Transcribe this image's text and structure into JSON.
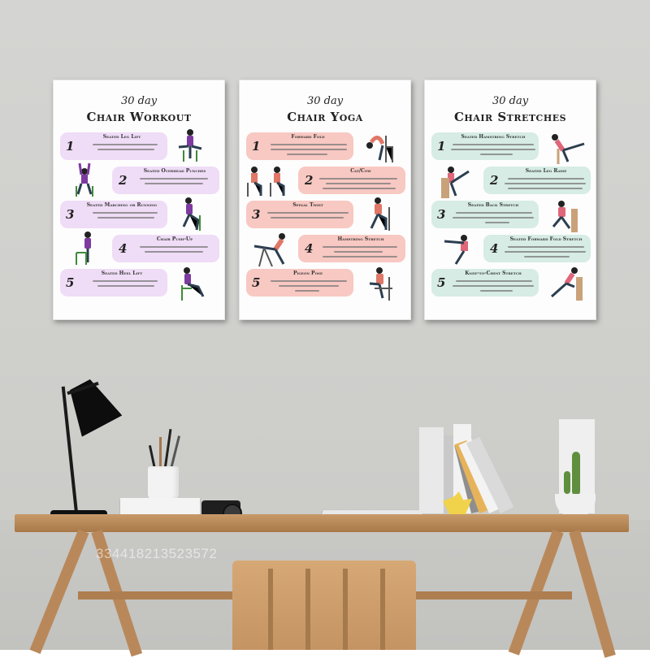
{
  "posters": [
    {
      "subtitle": "30 day",
      "title": "Chair Workout",
      "accent": "#efdcf6",
      "figure_color": "#7d3aa0",
      "items": [
        {
          "num": "1",
          "label": "Seated Leg Lift",
          "side": "left"
        },
        {
          "num": "2",
          "label": "Seated Overhead Punches",
          "side": "right"
        },
        {
          "num": "3",
          "label": "Seated Marching or Running",
          "side": "left"
        },
        {
          "num": "4",
          "label": "Chair Push-Up",
          "side": "right"
        },
        {
          "num": "5",
          "label": "Seated Heel Lift",
          "side": "left"
        }
      ]
    },
    {
      "subtitle": "30 day",
      "title": "Chair Yoga",
      "accent": "#f8c8c2",
      "figure_color": "#e07767",
      "items": [
        {
          "num": "1",
          "label": "Forward Fold",
          "side": "left"
        },
        {
          "num": "2",
          "label": "Cat/Cow",
          "side": "right"
        },
        {
          "num": "3",
          "label": "Spinal Twist",
          "side": "left"
        },
        {
          "num": "4",
          "label": "Hamstring Stretch",
          "side": "right"
        },
        {
          "num": "5",
          "label": "Pigeon Pose",
          "side": "left"
        }
      ]
    },
    {
      "subtitle": "30 day",
      "title": "Chair Stretches",
      "accent": "#d6ece4",
      "figure_color": "#e0667a",
      "items": [
        {
          "num": "1",
          "label": "Seated Hamstring Stretch",
          "side": "left"
        },
        {
          "num": "2",
          "label": "Seated Leg Raise",
          "side": "right"
        },
        {
          "num": "3",
          "label": "Seated Back Stretch",
          "side": "left"
        },
        {
          "num": "4",
          "label": "Seated Forward Fold Stretch",
          "side": "right"
        },
        {
          "num": "5",
          "label": "Knee-to-Chest Stretch",
          "side": "left"
        }
      ]
    }
  ],
  "watermark": "334418213523572",
  "colors": {
    "wall": "#d2d2cf",
    "desk": "#c4945f",
    "lamp": "#111111"
  }
}
